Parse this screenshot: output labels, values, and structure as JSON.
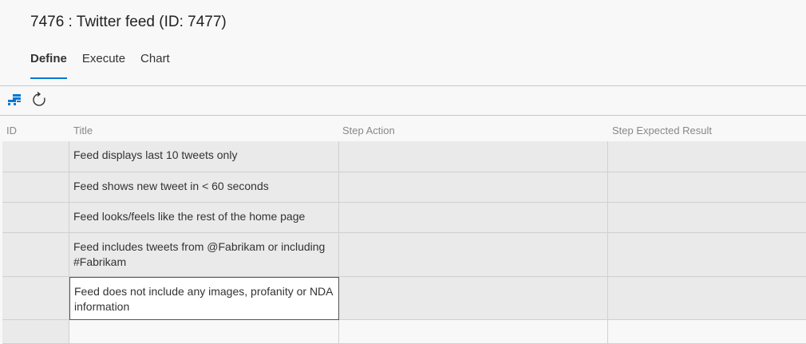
{
  "header": {
    "title": "7476 : Twitter feed (ID: 7477)",
    "tabs": [
      {
        "label": "Define",
        "active": true
      },
      {
        "label": "Execute",
        "active": false
      },
      {
        "label": "Chart",
        "active": false
      }
    ]
  },
  "toolbar": {
    "icons": [
      "grid-view-icon",
      "refresh-icon"
    ]
  },
  "grid": {
    "columns": [
      "ID",
      "Title",
      "Step Action",
      "Step Expected Result"
    ],
    "rows": [
      {
        "id": "",
        "title": "Feed displays last 10 tweets only",
        "action": "",
        "expected": ""
      },
      {
        "id": "",
        "title": "Feed shows new tweet in < 60 seconds",
        "action": "",
        "expected": ""
      },
      {
        "id": "",
        "title": "Feed looks/feels like the rest of the home page",
        "action": "",
        "expected": ""
      },
      {
        "id": "",
        "title": "Feed includes tweets from @Fabrikam or including #Fabrikam",
        "action": "",
        "expected": ""
      },
      {
        "id": "",
        "title": "Feed does not include any images, profanity or NDA information",
        "action": "",
        "expected": ""
      },
      {
        "id": "",
        "title": "",
        "action": "",
        "expected": ""
      }
    ],
    "selected_row": 4
  },
  "colors": {
    "accent": "#0078d4",
    "row_bg": "#eaeaea",
    "page_bg": "#f8f8f8"
  }
}
